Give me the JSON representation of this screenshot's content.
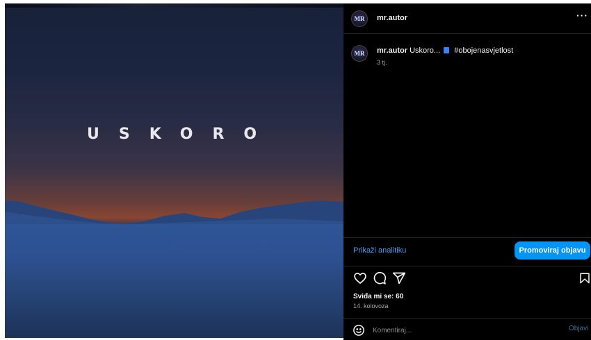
{
  "post": {
    "image_text": "USKORO",
    "accent_colors": {
      "promote": "#0095f6",
      "link": "#4a9cf0",
      "panel": "#000000"
    }
  },
  "header": {
    "avatar_initials": "MR",
    "username": "mr.autor",
    "more_icon": "more-horizontal-icon",
    "more_label": "···"
  },
  "caption": {
    "avatar_initials": "MR",
    "username": "mr.autor",
    "text_before": "Uskoro...",
    "emoji_icon": "blue-book-icon",
    "text_after": "#obojenasvjetlost",
    "age": "3 tj."
  },
  "actions": {
    "analytics_label": "Prikaži analitiku",
    "promote_label": "Promoviraj objavu"
  },
  "icons": [
    "heart-icon",
    "comment-icon",
    "share-icon",
    "bookmark-icon"
  ],
  "likes": "Sviđa mi se: 60",
  "date": "14. kolovoza",
  "comment": {
    "emoji_icon": "emoji-icon",
    "placeholder": "Komentiraj...",
    "post_label": "Objavi"
  }
}
